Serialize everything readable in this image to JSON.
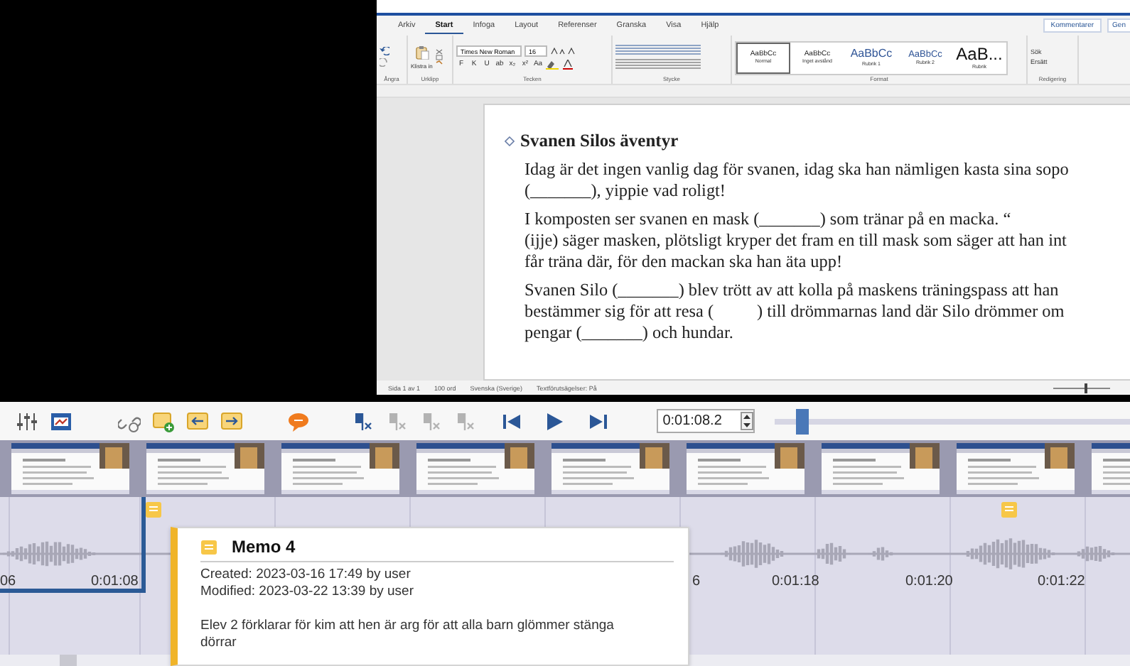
{
  "word": {
    "tabs": [
      {
        "label": "Arkiv",
        "selected": false
      },
      {
        "label": "Start",
        "selected": true
      },
      {
        "label": "Infoga",
        "selected": false
      },
      {
        "label": "Layout",
        "selected": false
      },
      {
        "label": "Referenser",
        "selected": false
      },
      {
        "label": "Granska",
        "selected": false
      },
      {
        "label": "Visa",
        "selected": false
      },
      {
        "label": "Hjälp",
        "selected": false
      }
    ],
    "comments_button": "Kommentarer",
    "review_button": "Gen",
    "ribbon": {
      "undo_group": "Ångra",
      "paste": "Klistra in",
      "clipboard_group": "Urklipp",
      "font": "Times New Roman",
      "size": "16",
      "format_buttons": [
        "F",
        "K",
        "U",
        "ab",
        "x₂",
        "x²",
        "Aa"
      ],
      "font_group": "Tecken",
      "paragraph_group": "Stycke",
      "styles": [
        {
          "kind": "normal",
          "sample": "AaBbCc",
          "name": "Normal",
          "selected": true
        },
        {
          "kind": "normal",
          "sample": "AaBbCc",
          "name": "Inget avstånd",
          "selected": false
        },
        {
          "kind": "heading1",
          "sample": "AaBbCc",
          "name": "Rubrik 1",
          "selected": false
        },
        {
          "kind": "heading2",
          "sample": "AaBbCc",
          "name": "Rubrik 2",
          "selected": false
        },
        {
          "kind": "title",
          "sample": "AaB...",
          "name": "Rubrik",
          "selected": false
        }
      ],
      "styles_group": "Format",
      "search": "Sök",
      "replace": "Ersätt",
      "editing_group": "Redigering"
    },
    "document": {
      "heading": "Svanen Silos äventyr",
      "paragraphs": [
        {
          "lines": [
            "Idag är det ingen vanlig dag för svanen, idag ska han nämligen kasta sina sopo",
            "(_______), yippie vad roligt!"
          ]
        },
        {
          "lines": [
            "I komposten ser svanen en mask (_______) som tränar på en macka. “",
            "(ijje) säger masken, plötsligt kryper det fram en till mask som säger att han int",
            "får träna där, för den mackan ska han äta upp!"
          ]
        },
        {
          "lines": [
            "Svanen Silo (_______) blev trött av att kolla på maskens träningspass att han",
            "bestämmer sig för att resa (          ) till drömmarnas land där Silo drömmer om",
            "pengar (_______) och hundar."
          ]
        }
      ]
    },
    "status_bar": [
      "Sida 1 av 1",
      "100 ord",
      "Svenska (Sverige)",
      "Textförutsägelser: På"
    ],
    "zoom": {
      "level": 0.55
    }
  },
  "toolbar": {
    "items": [
      {
        "kind": "sliders",
        "disabled": false
      },
      {
        "kind": "film",
        "disabled": false
      },
      {
        "kind": "link",
        "disabled": false
      },
      {
        "kind": "note-add",
        "disabled": false
      },
      {
        "kind": "note-prev",
        "disabled": false
      },
      {
        "kind": "note-next",
        "disabled": false
      },
      {
        "kind": "speech",
        "disabled": false
      },
      {
        "kind": "marker",
        "disabled": false
      },
      {
        "kind": "marker",
        "disabled": true
      },
      {
        "kind": "marker",
        "disabled": true
      },
      {
        "kind": "marker",
        "disabled": true
      },
      {
        "kind": "skip-back",
        "disabled": false
      },
      {
        "kind": "play",
        "disabled": false
      },
      {
        "kind": "skip-forward",
        "disabled": false
      }
    ],
    "timecode": "0:01:08.2",
    "zoom": {
      "level": 0.06
    }
  },
  "timeline": {
    "labels": [
      "06",
      "0:01:08",
      "6",
      "0:01:18",
      "0:01:20",
      "0:01:22"
    ]
  },
  "memo_popup": {
    "title": "Memo 4",
    "created": "Created: 2023-03-16 17:49 by user",
    "modified": "Modified: 2023-03-22 13:39 by user",
    "text": "Elev 2 förklarar för kim att hen är arg för att alla barn glömmer stänga dörrar"
  }
}
